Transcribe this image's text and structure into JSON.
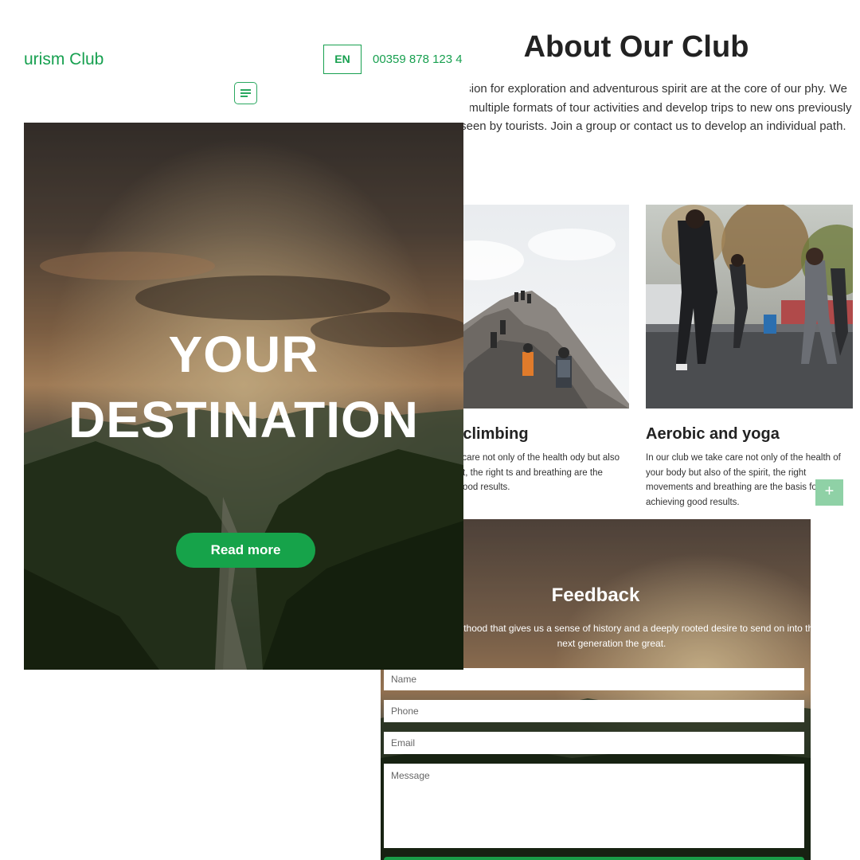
{
  "header": {
    "logo_text": "urism Club",
    "lang": "EN",
    "phone": "00359 878 123 4"
  },
  "hero": {
    "title_line1": "YOUR",
    "title_line2": "DESTINATION",
    "button_label": "Read more"
  },
  "about": {
    "title": "About Our Club",
    "intro": "passion for exploration and adventurous spirit are at the core of our phy. We offer multiple formats of tour activities and develop trips to new ons previously unseen by tourists. Join a group or contact us to develop an individual path.",
    "cards": [
      {
        "title": "ntain climbing",
        "text": "p we take care not only of the health ody but also of the spirit, the right ts and breathing are the basis for good results."
      },
      {
        "title": "Aerobic and yoga",
        "text": "In our club we take care not only of the health of your body but also of the spirit, the right movements and breathing are the basis for achieving good results."
      }
    ],
    "plus_label": "+"
  },
  "feedback": {
    "title": "Feedback",
    "text": "g about parenthood that gives us a sense of history and a deeply rooted desire to send on into the next generation the great.",
    "name_placeholder": "Name",
    "phone_placeholder": "Phone",
    "email_placeholder": "Email",
    "message_placeholder": "Message"
  },
  "colors": {
    "brand_green": "#18a050",
    "button_green": "#16a34a",
    "plus_green": "#8fd1a6"
  },
  "icons": {
    "menu": "menu-icon",
    "plus": "plus-icon"
  }
}
